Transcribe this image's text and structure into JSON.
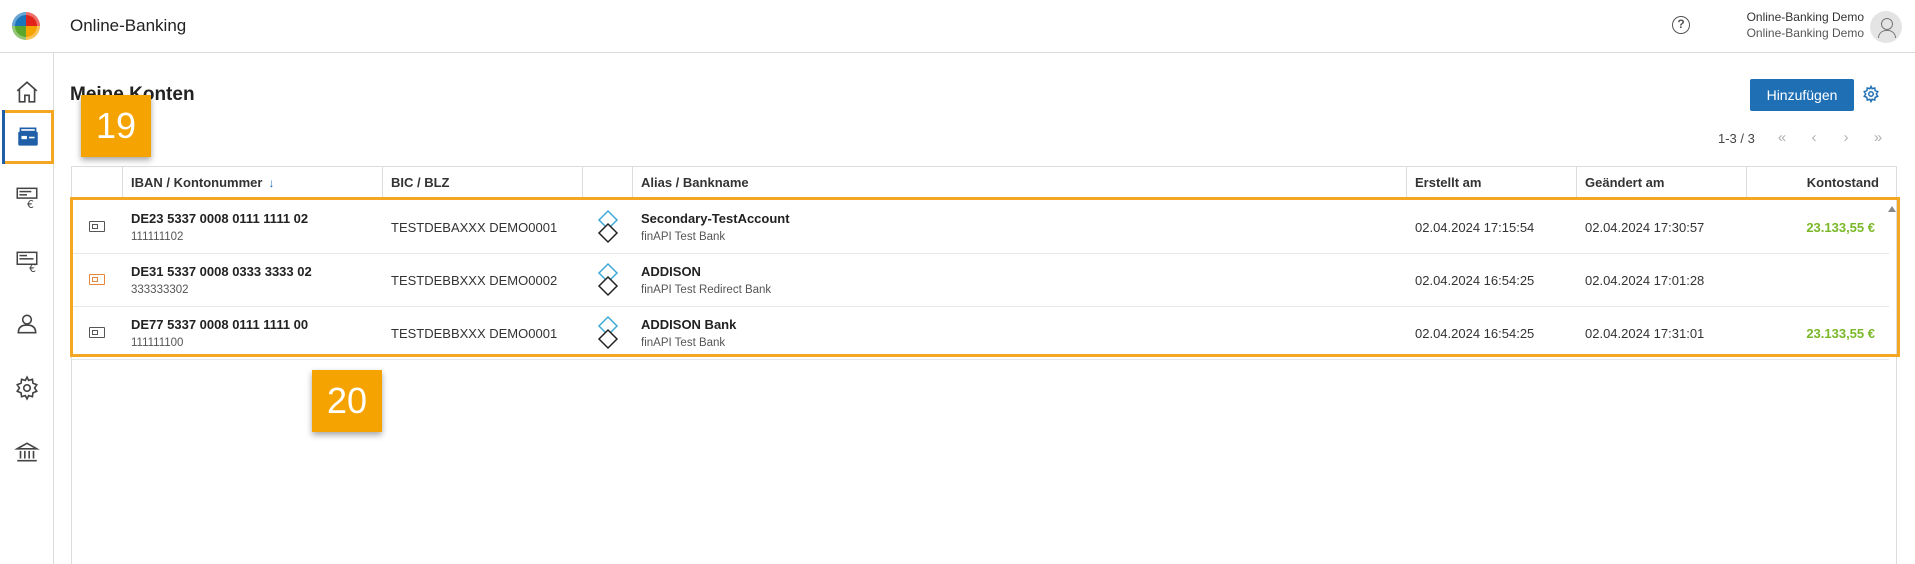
{
  "header": {
    "app_title": "Online-Banking",
    "user_line1": "Online-Banking Demo",
    "user_line2": "Online-Banking Demo",
    "help_symbol": "?"
  },
  "sidebar": {
    "items": [
      {
        "name": "home-icon"
      },
      {
        "name": "accounts-icon",
        "active": true
      },
      {
        "name": "transfer-icon"
      },
      {
        "name": "statement-icon"
      },
      {
        "name": "user-icon"
      },
      {
        "name": "settings-icon"
      },
      {
        "name": "bank-icon"
      }
    ]
  },
  "main": {
    "page_title": "Meine Konten",
    "add_button": "Hinzufügen",
    "pager": {
      "text": "1-3 / 3",
      "first": "«",
      "prev": "‹",
      "next": "›",
      "last": "»"
    }
  },
  "table": {
    "columns": [
      "IBAN / Kontonummer",
      "BIC / BLZ",
      "",
      "Alias / Bankname",
      "Erstellt am",
      "Geändert am",
      "Kontostand"
    ],
    "sort_indicator": "↓",
    "rows": [
      {
        "status": "ok",
        "iban": "DE23 5337 0008 0111 1111 02",
        "kontonummer": "111111102",
        "bic": "TESTDEBAXXX DEMO0001",
        "alias": "Secondary-TestAccount",
        "bank": "finAPI Test Bank",
        "created": "02.04.2024 17:15:54",
        "changed": "02.04.2024 17:30:57",
        "balance": "23.133,55 €"
      },
      {
        "status": "warn",
        "iban": "DE31 5337 0008 0333 3333 02",
        "kontonummer": "333333302",
        "bic": "TESTDEBBXXX DEMO0002",
        "alias": "ADDISON",
        "bank": "finAPI Test Redirect Bank",
        "created": "02.04.2024 16:54:25",
        "changed": "02.04.2024 17:01:28",
        "balance": ""
      },
      {
        "status": "ok",
        "iban": "DE77 5337 0008 0111 1111 00",
        "kontonummer": "111111100",
        "bic": "TESTDEBBXXX DEMO0001",
        "alias": "ADDISON Bank",
        "bank": "finAPI Test Bank",
        "created": "02.04.2024 16:54:25",
        "changed": "02.04.2024 17:31:01",
        "balance": "23.133,55 €"
      }
    ]
  },
  "annotations": {
    "badge_1": "19",
    "badge_2": "20",
    "color": "#f5a623"
  },
  "colors": {
    "primary": "#1f6fb5",
    "positive_balance": "#7ab828",
    "warning": "#e8873a"
  }
}
